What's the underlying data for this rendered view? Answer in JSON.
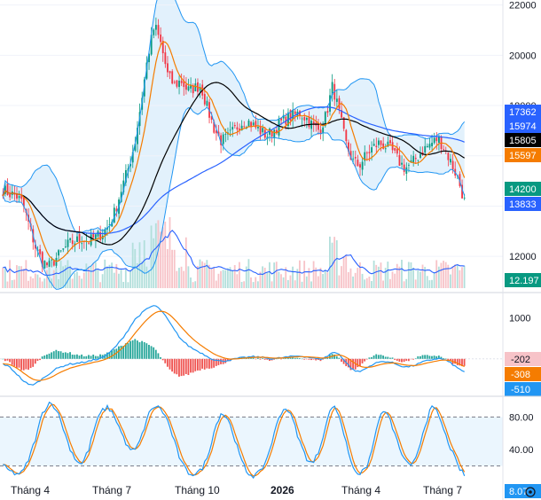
{
  "chart_data": [
    {
      "type": "candlestick",
      "panel": "price",
      "y_ticks": [
        12000,
        14000,
        16000,
        18000,
        20000,
        22000
      ],
      "y_tick_labels": [
        "12000",
        "14000",
        "16000",
        "18000",
        "20000",
        "22000"
      ],
      "ylim": [
        10700,
        22200
      ],
      "x_labels": [
        "Tháng 4",
        "Tháng 7",
        "Tháng 10",
        "2026",
        "Tháng 4",
        "Tháng 7"
      ],
      "close_path": [
        14650,
        14500,
        14420,
        14100,
        13200,
        12300,
        11800,
        11600,
        11900,
        12200,
        12500,
        12600,
        12700,
        12600,
        12750,
        12900,
        13200,
        13800,
        14700,
        15500,
        16500,
        18200,
        20000,
        21200,
        20400,
        19200,
        18800,
        19000,
        18600,
        18700,
        18800,
        17900,
        17100,
        16600,
        16700,
        17000,
        17300,
        17400,
        17200,
        17000,
        16800,
        17000,
        17300,
        17500,
        17600,
        17700,
        17500,
        17200,
        17000,
        17600,
        18800,
        17700,
        16500,
        15800,
        15600,
        16000,
        16300,
        16500,
        16400,
        16200,
        15800,
        15500,
        15700,
        16000,
        16300,
        16500,
        16700,
        16300,
        15700,
        15100,
        14200
      ],
      "series": [
        {
          "name": "Volume",
          "badge": "12.197",
          "color": "#2962ff"
        }
      ],
      "price_badges": [
        {
          "value": "17362",
          "color": "#2962ff"
        },
        {
          "value": "15974",
          "color": "#2962ff"
        },
        {
          "value": "15805",
          "color": "#000000"
        },
        {
          "value": "15597",
          "color": "#f57c00"
        },
        {
          "value": "14200",
          "color": "#089981"
        },
        {
          "value": "13833",
          "color": "#2962ff"
        }
      ],
      "colors": {
        "up": "#089981",
        "down": "#f23645",
        "band": "#2196f3",
        "band_fill": "#dbeefb",
        "ma_fast": "#f57c00",
        "ma_slow": "#000000",
        "ma_long": "#2962ff"
      }
    },
    {
      "type": "line",
      "panel": "macd",
      "y_ticks": [
        1000,
        0
      ],
      "y_tick_labels": [
        "1000",
        "0"
      ],
      "macd_values": [
        -120,
        -200,
        -350,
        -520,
        -640,
        -600,
        -480,
        -360,
        -250,
        -180,
        -130,
        -110,
        -90,
        -60,
        -20,
        30,
        120,
        280,
        470,
        700,
        950,
        1100,
        1230,
        1300,
        1180,
        950,
        700,
        480,
        330,
        230,
        150,
        60,
        -20,
        -60,
        -40,
        -10,
        20,
        40,
        50,
        40,
        20,
        0,
        20,
        40,
        60,
        70,
        50,
        20,
        -10,
        40,
        160,
        120,
        -80,
        -260,
        -320,
        -240,
        -140,
        -80,
        -60,
        -90,
        -150,
        -200,
        -180,
        -120,
        -60,
        -20,
        10,
        -20,
        -110,
        -230,
        -308
      ],
      "badges": [
        {
          "value": "-202",
          "color": "#f7c3c8"
        },
        {
          "value": "-308",
          "color": "#f57c00"
        },
        {
          "value": "-510",
          "color": "#2196f3"
        }
      ],
      "colors": {
        "macd": "#2196f3",
        "signal": "#f57c00",
        "hist_up": "#26a69a",
        "hist_down": "#ef5350"
      }
    },
    {
      "type": "line",
      "panel": "stochastic",
      "y_ticks": [
        80,
        40
      ],
      "y_tick_labels": [
        "80.00",
        "40.00"
      ],
      "bands": [
        80,
        20
      ],
      "stoch_values": [
        20,
        14,
        10,
        12,
        30,
        55,
        85,
        98,
        92,
        70,
        45,
        28,
        22,
        40,
        70,
        88,
        92,
        80,
        60,
        42,
        38,
        55,
        82,
        94,
        90,
        75,
        50,
        25,
        12,
        10,
        14,
        30,
        62,
        85,
        80,
        58,
        30,
        12,
        8,
        12,
        28,
        55,
        84,
        92,
        76,
        50,
        30,
        22,
        40,
        72,
        95,
        82,
        50,
        20,
        10,
        15,
        40,
        78,
        88,
        70,
        45,
        25,
        18,
        40,
        70,
        92,
        85,
        60,
        40,
        20,
        8.07
      ],
      "badges": [
        {
          "value": "8.07",
          "color": "#2196f3"
        }
      ],
      "colors": {
        "k": "#2196f3",
        "d": "#f57c00",
        "band_fill": "#e3f2fd"
      }
    }
  ]
}
